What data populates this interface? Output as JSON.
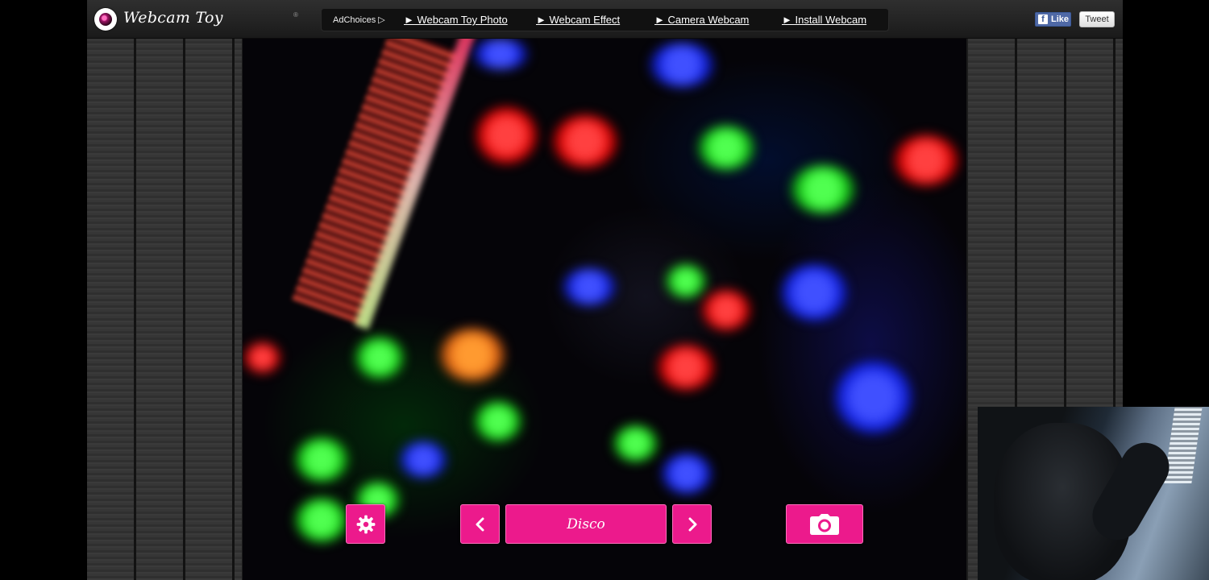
{
  "app": {
    "name": "Webcam Toy",
    "registered_mark": "®"
  },
  "nav": {
    "adchoices": "AdChoices ▷",
    "links": [
      "► Webcam Toy Photo",
      "► Webcam Effect",
      "► Camera Webcam",
      "► Install Webcam"
    ]
  },
  "social": {
    "like_label": "Like",
    "fb_glyph": "f",
    "tweet_label": "Tweet"
  },
  "controls": {
    "effect_name": "Disco",
    "settings_icon": "gear-icon",
    "prev_icon": "chevron-left-icon",
    "next_icon": "chevron-right-icon",
    "capture_icon": "camera-icon"
  },
  "colors": {
    "accent": "#ec1a8c",
    "topbar": "#262626",
    "background": "#000000"
  }
}
